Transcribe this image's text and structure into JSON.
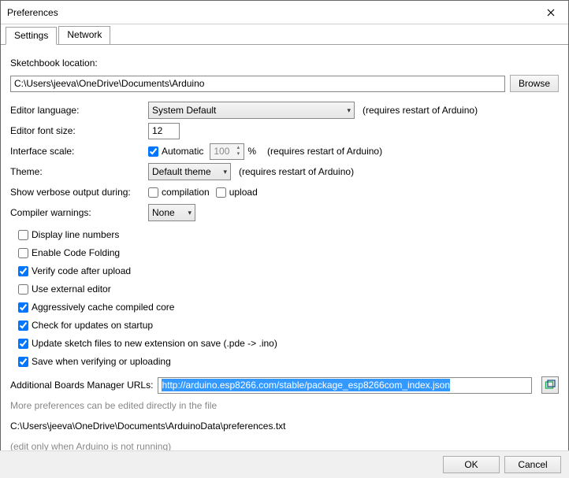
{
  "window": {
    "title": "Preferences"
  },
  "tabs": {
    "settings": "Settings",
    "network": "Network"
  },
  "labels": {
    "sketchbook": "Sketchbook location:",
    "browse": "Browse",
    "editor_lang": "Editor language:",
    "restart_note": "(requires restart of Arduino)",
    "font_size": "Editor font size:",
    "iface_scale": "Interface scale:",
    "automatic": "Automatic",
    "percent": "%",
    "theme": "Theme:",
    "verbose": "Show verbose output during:",
    "compilation": "compilation",
    "upload": "upload",
    "compiler_warn": "Compiler warnings:",
    "boards_url": "Additional Boards Manager URLs:",
    "more_prefs": "More preferences can be edited directly in the file",
    "edit_note": "(edit only when Arduino is not running)"
  },
  "values": {
    "sketchbook_path": "C:\\Users\\jeeva\\OneDrive\\Documents\\Arduino",
    "language": "System Default",
    "font_size": "12",
    "scale": "100",
    "theme": "Default theme",
    "warnings": "None",
    "boards_url": "http://arduino.esp8266.com/stable/package_esp8266com_index.json",
    "prefs_path": "C:\\Users\\jeeva\\OneDrive\\Documents\\ArduinoData\\preferences.txt"
  },
  "options": {
    "line_numbers": {
      "label": "Display line numbers",
      "checked": false
    },
    "code_folding": {
      "label": "Enable Code Folding",
      "checked": false
    },
    "verify_upload": {
      "label": "Verify code after upload",
      "checked": true
    },
    "external_editor": {
      "label": "Use external editor",
      "checked": false
    },
    "cache_core": {
      "label": "Aggressively cache compiled core",
      "checked": true
    },
    "check_updates": {
      "label": "Check for updates on startup",
      "checked": true
    },
    "update_ext": {
      "label": "Update sketch files to new extension on save (.pde -> .ino)",
      "checked": true
    },
    "save_verify": {
      "label": "Save when verifying or uploading",
      "checked": true
    }
  },
  "checks": {
    "automatic": true,
    "compilation": false,
    "upload": false
  },
  "buttons": {
    "ok": "OK",
    "cancel": "Cancel"
  }
}
